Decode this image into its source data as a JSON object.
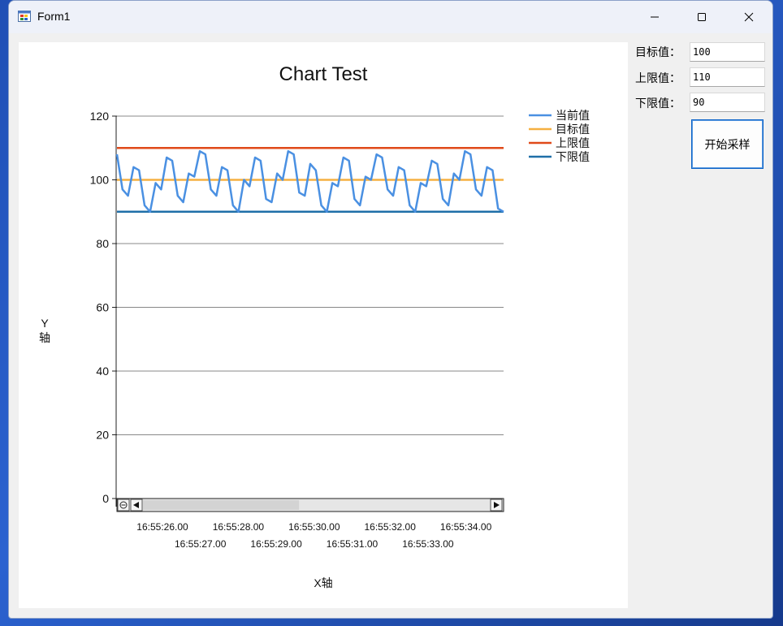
{
  "window": {
    "title": "Form1"
  },
  "controls": {
    "target_label": "目标值：",
    "target_value": "100",
    "upper_label": "上限值：",
    "upper_value": "110",
    "lower_label": "下限值：",
    "lower_value": "90",
    "start_button": "开始采样"
  },
  "icons": {
    "app": "form-app-icon",
    "minimize": "minimize-icon",
    "maximize": "maximize-icon",
    "close": "close-icon",
    "scroll_left": "scroll-left-arrow-icon",
    "scroll_right": "scroll-right-arrow-icon",
    "zoom_reset": "zoom-reset-icon"
  },
  "chart_data": {
    "type": "line",
    "title": "Chart Test",
    "xlabel": "X轴",
    "ylabel_lines": [
      "Y",
      "轴"
    ],
    "ylim": [
      0,
      120
    ],
    "yticks": [
      0,
      20,
      40,
      60,
      80,
      100,
      120
    ],
    "grid": true,
    "legend_position": "top-right",
    "x_tick_labels": [
      "16:55:26.00",
      "16:55:27.00",
      "16:55:28.00",
      "16:55:29.00",
      "16:55:30.00",
      "16:55:31.00",
      "16:55:32.00",
      "16:55:33.00",
      "16:55:34.00"
    ],
    "scrollbar_view_fraction": [
      0,
      0.45
    ],
    "series": [
      {
        "name": "当前值",
        "color": "#4a90e2",
        "values": [
          108,
          97,
          95,
          104,
          103,
          92,
          90,
          99,
          97,
          107,
          106,
          95,
          93,
          102,
          101,
          109,
          108,
          97,
          95,
          104,
          103,
          92,
          90,
          100,
          98,
          107,
          106,
          94,
          93,
          102,
          100,
          109,
          108,
          96,
          95,
          105,
          103,
          92,
          90,
          99,
          98,
          107,
          106,
          94,
          92,
          101,
          100,
          108,
          107,
          97,
          95,
          104,
          103,
          92,
          90,
          99,
          98,
          106,
          105,
          94,
          92,
          102,
          100,
          109,
          108,
          97,
          95,
          104,
          103,
          91,
          90
        ]
      },
      {
        "name": "目标值",
        "color": "#f5b041",
        "constant": 100
      },
      {
        "name": "上限值",
        "color": "#e04a1a",
        "constant": 110
      },
      {
        "name": "下限值",
        "color": "#1f6fa8",
        "constant": 90
      }
    ]
  }
}
